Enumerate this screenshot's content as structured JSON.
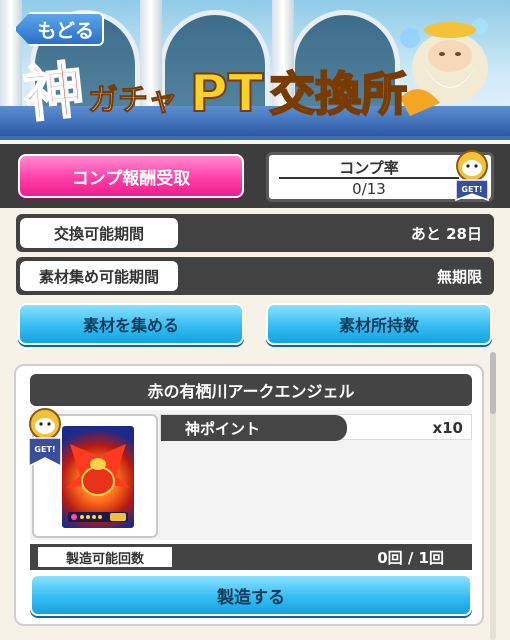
{
  "header": {
    "back_label": "もどる",
    "title_kami": "神",
    "title_gacha": "ガチャ",
    "title_pt": "PT",
    "title_exchange": "交換所"
  },
  "comp": {
    "claim_label": "コンプ報酬受取",
    "rate_label": "コンプ率",
    "rate_value": "0/13",
    "badge_text": "GET!"
  },
  "info": {
    "period_label": "交換可能期間",
    "period_value": "あと 28日",
    "collect_label": "素材集め可能期間",
    "collect_value": "無期限"
  },
  "actions": {
    "collect_label": "素材を集める",
    "owned_label": "素材所持数"
  },
  "item": {
    "name": "赤の有栖川アークエンジェル",
    "badge_text": "GET!",
    "material_name": "神ポイント",
    "material_qty": "x10",
    "craft_count_label": "製造可能回数",
    "craft_count_value": "0回 / 1回",
    "craft_label": "製造する"
  },
  "colors": {
    "pink_button": "#ff3fa7",
    "blue_button": "#36bdf3",
    "dark_panel": "#424242"
  }
}
